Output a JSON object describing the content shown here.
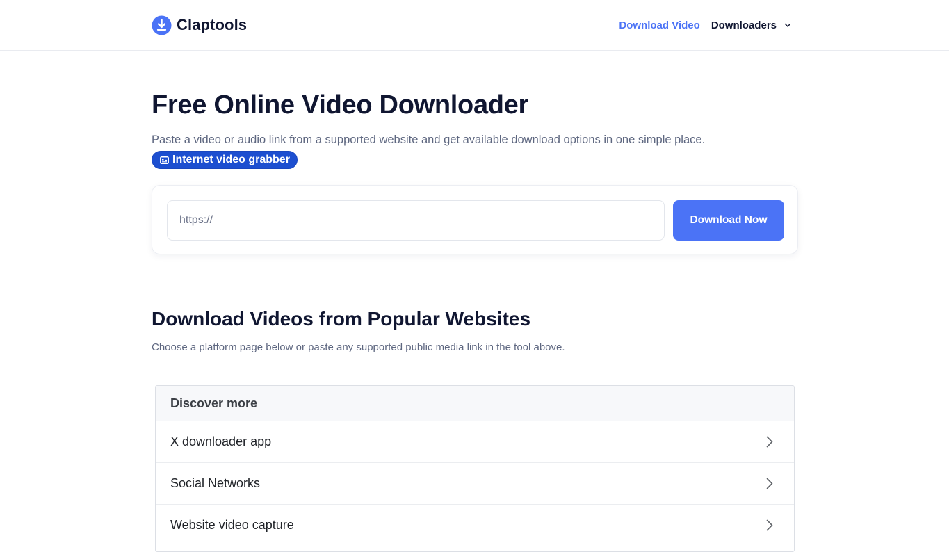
{
  "header": {
    "brand": "Claptools",
    "nav": {
      "download_video": "Download Video",
      "downloaders": "Downloaders"
    }
  },
  "hero": {
    "title": "Free Online Video Downloader",
    "subtitle": "Paste a video or audio link from a supported website and get available download options in one simple place.",
    "badge": "Internet video grabber"
  },
  "search": {
    "placeholder": "https://",
    "value": "",
    "button": "Download Now"
  },
  "popular": {
    "title": "Download Videos from Popular Websites",
    "subtitle": "Choose a platform page below or paste any supported public media link in the tool above."
  },
  "discover": {
    "heading": "Discover more",
    "items": [
      {
        "label": "X downloader app"
      },
      {
        "label": "Social Networks"
      },
      {
        "label": "Website video capture"
      }
    ]
  },
  "colors": {
    "accent": "#4b73f6",
    "badge": "#1d4fd0",
    "heading": "#101631",
    "muted": "#5e6780"
  }
}
